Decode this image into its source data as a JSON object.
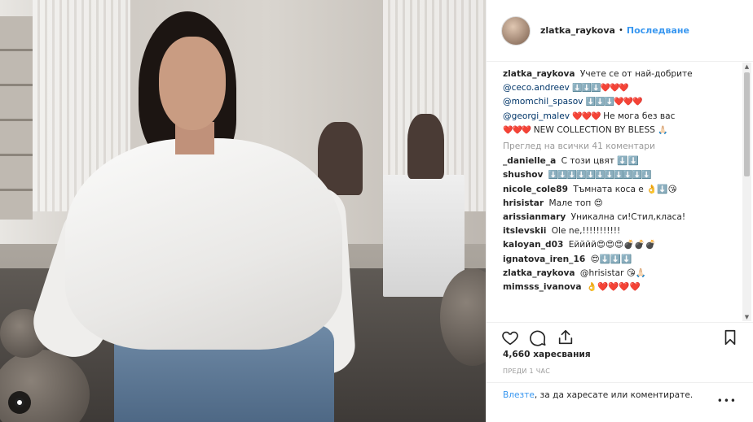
{
  "header": {
    "username": "zlatka_raykova",
    "separator": "•",
    "follow_label": "Последване"
  },
  "caption": {
    "user": "zlatka_raykova",
    "line1": "Учете се от най-добрите",
    "m1": "@ceco.andreev",
    "e1": "⬇️⬇️⬇️❤️❤️❤️",
    "m2": "@momchil_spasov",
    "e2": "⬇️⬇️⬇️❤️❤️❤️",
    "m3": "@georgi_malev",
    "e3": "❤️❤️❤️",
    "text3": "Не мога без вас",
    "e4": "❤️❤️❤️",
    "text4": "NEW COLLECTION BY BLESS",
    "e5": "🙏🏻"
  },
  "view_all_label": "Преглед на всички 41 коментари",
  "comments": [
    {
      "user": "_danielle_a",
      "text": "С този цвят ⬇️⬇️"
    },
    {
      "user": "shushov",
      "text": "⬇️⬇️⬇️⬇️⬇️⬇️⬇️⬇️⬇️⬇️⬇️"
    },
    {
      "user": "nicole_cole89",
      "text": "Тъмната коса е 👌⬇️😘"
    },
    {
      "user": "hrisistar",
      "text": "Мале топ 😍"
    },
    {
      "user": "arissianmary",
      "text": "Уникална си!Стил,класа!"
    },
    {
      "user": "itslevskii",
      "text": "Ole ne,!!!!!!!!!!!"
    },
    {
      "user": "kaloyan_d03",
      "text": "Ейййй😍😍😍💣💣💣"
    },
    {
      "user": "ignatova_iren_16",
      "text": "😍⬇️⬇️⬇️"
    },
    {
      "user": "zlatka_raykova",
      "text": "@hrisistar 😘🙏🏻"
    },
    {
      "user": "mimsss_ivanova",
      "text": "👌❤️❤️❤️❤️"
    }
  ],
  "likes_label": "4,660 харесвания",
  "time_label": "ПРЕДИ 1 ЧАС",
  "login": {
    "link": "Влезте",
    "text": ", за да харесате или коментирате."
  },
  "more_label": "•••",
  "scroll": {
    "up": "▲",
    "down": "▼"
  },
  "icons": [
    "heart-icon",
    "comment-icon",
    "share-icon",
    "bookmark-icon",
    "gallery-media-icon"
  ],
  "colors": {
    "link": "#3897f0",
    "mention": "#003569",
    "muted": "#999999"
  }
}
